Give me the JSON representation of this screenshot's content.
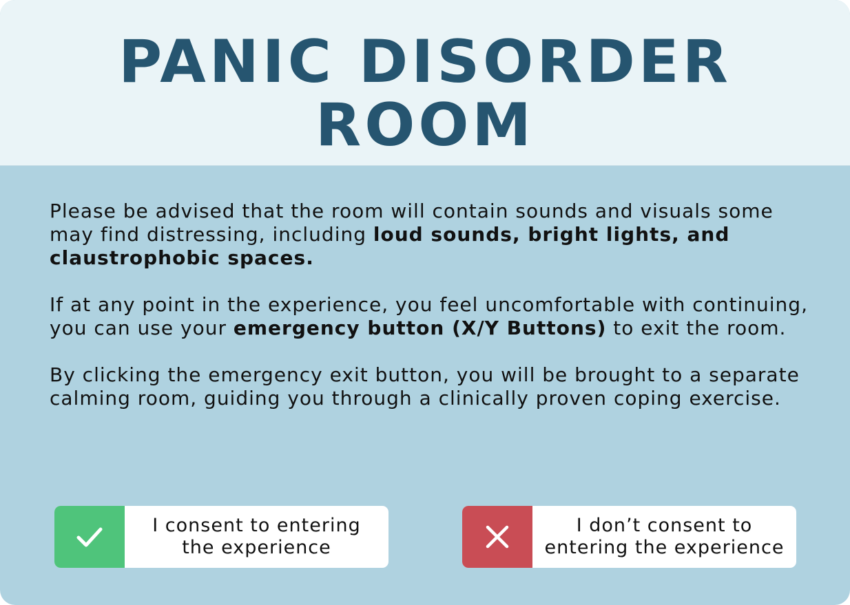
{
  "colors": {
    "header_bg": "#eaf4f7",
    "body_bg": "#afd2e0",
    "title": "#265570",
    "consent_green": "#4fc47b",
    "decline_red": "#c94d55"
  },
  "header": {
    "title_line1": "PANIC DISORDER",
    "title_line2": "ROOM"
  },
  "warning": {
    "p1_text": "Please be advised that the room will contain sounds and visuals some may find distressing, including ",
    "p1_bold": "loud sounds, bright lights, and claustrophobic spaces",
    "p1_end": ".",
    "p2_text": "If at any point in the experience, you feel uncomfortable with continuing, you can use your ",
    "p2_bold": "emergency button (X/Y Buttons)",
    "p2_end": " to exit the room.",
    "p3_text": "By clicking the emergency exit button, you will be brought to a separate calming room, guiding you through a clinically proven coping exercise."
  },
  "actions": {
    "consent": {
      "icon": "checkmark-icon",
      "label": "I consent to entering the experience"
    },
    "decline": {
      "icon": "close-icon",
      "label": "I don’t consent to entering the experience"
    }
  }
}
